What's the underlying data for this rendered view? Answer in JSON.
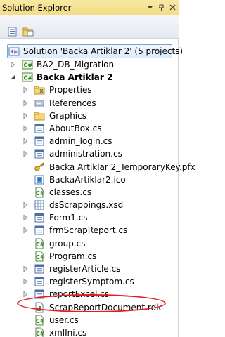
{
  "window": {
    "title": "Solution Explorer"
  },
  "toolbar": {
    "buttons": [
      {
        "name": "properties",
        "icon": "properties-icon"
      },
      {
        "name": "show-all-files",
        "icon": "show-all-files-icon"
      }
    ]
  },
  "tree": {
    "solution": {
      "label": "Solution 'Backa Artiklar 2' (5 projects)",
      "icon": "solution-icon"
    },
    "items": [
      {
        "label": "BA2_DB_Migration",
        "icon": "csharp-project-icon",
        "level": 1,
        "expander": "collapsed"
      },
      {
        "label": "Backa Artiklar 2",
        "icon": "csharp-project-icon",
        "level": 1,
        "expander": "expanded",
        "bold": true
      },
      {
        "label": "Properties",
        "icon": "properties-folder-icon",
        "level": 2,
        "expander": "collapsed"
      },
      {
        "label": "References",
        "icon": "references-icon",
        "level": 2,
        "expander": "collapsed"
      },
      {
        "label": "Graphics",
        "icon": "folder-icon",
        "level": 2,
        "expander": "collapsed"
      },
      {
        "label": "AboutBox.cs",
        "icon": "form-file-icon",
        "level": 2,
        "expander": "collapsed"
      },
      {
        "label": "admin_login.cs",
        "icon": "form-file-icon",
        "level": 2,
        "expander": "collapsed"
      },
      {
        "label": "administration.cs",
        "icon": "form-file-icon",
        "level": 2,
        "expander": "collapsed"
      },
      {
        "label": "Backa Artiklar 2_TemporaryKey.pfx",
        "icon": "key-icon",
        "level": 2,
        "expander": "none"
      },
      {
        "label": "BackaArtiklar2.ico",
        "icon": "ico-file-icon",
        "level": 2,
        "expander": "none"
      },
      {
        "label": "classes.cs",
        "icon": "csharp-file-icon",
        "level": 2,
        "expander": "none"
      },
      {
        "label": "dsScrappings.xsd",
        "icon": "dataset-icon",
        "level": 2,
        "expander": "collapsed"
      },
      {
        "label": "Form1.cs",
        "icon": "form-file-icon",
        "level": 2,
        "expander": "collapsed"
      },
      {
        "label": "frmScrapReport.cs",
        "icon": "form-file-icon",
        "level": 2,
        "expander": "collapsed"
      },
      {
        "label": "group.cs",
        "icon": "csharp-file-icon",
        "level": 2,
        "expander": "none"
      },
      {
        "label": "Program.cs",
        "icon": "csharp-file-icon",
        "level": 2,
        "expander": "none"
      },
      {
        "label": "registerArticle.cs",
        "icon": "form-file-icon",
        "level": 2,
        "expander": "collapsed"
      },
      {
        "label": "registerSymptom.cs",
        "icon": "form-file-icon",
        "level": 2,
        "expander": "collapsed"
      },
      {
        "label": "reportExcel.cs",
        "icon": "form-file-icon",
        "level": 2,
        "expander": "collapsed"
      },
      {
        "label": "ScrapReportDocument.rdlc",
        "icon": "report-file-icon",
        "level": 2,
        "expander": "none"
      },
      {
        "label": "user.cs",
        "icon": "csharp-file-icon",
        "level": 2,
        "expander": "none"
      },
      {
        "label": "xmlIni.cs",
        "icon": "csharp-file-icon",
        "level": 2,
        "expander": "none"
      }
    ]
  },
  "colors": {
    "titlebar": "#f3dc84",
    "selection_border": "#7da2ce",
    "annotation": "#e31c1c"
  }
}
